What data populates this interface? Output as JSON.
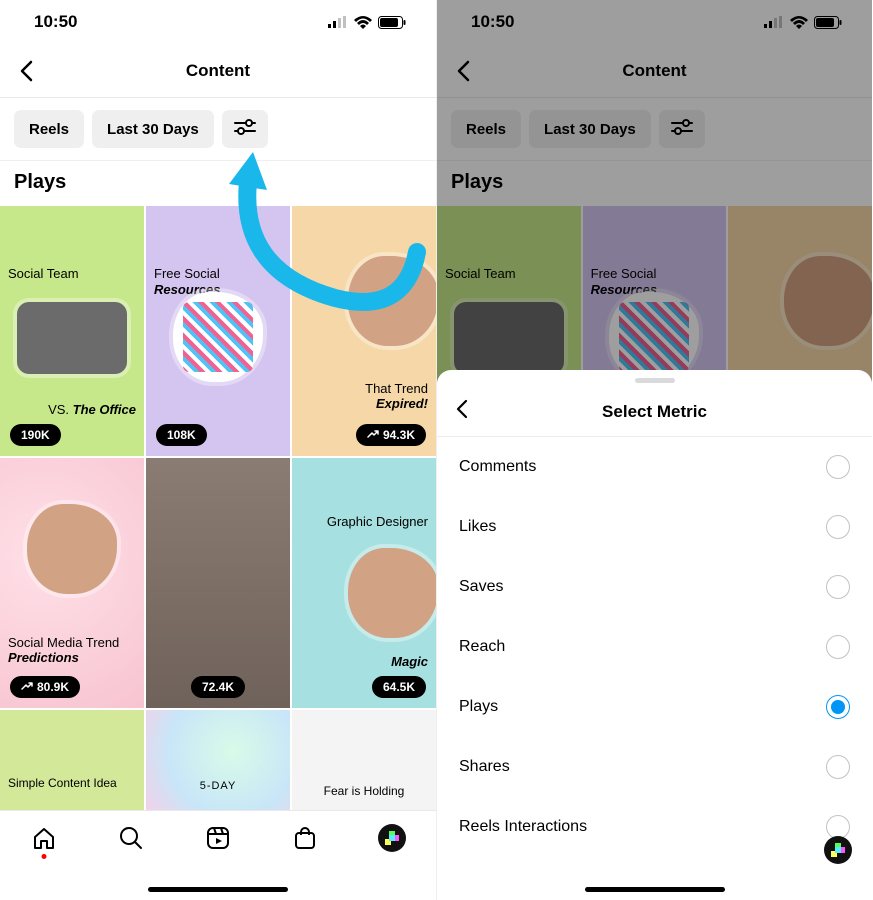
{
  "status": {
    "time": "10:50"
  },
  "header": {
    "title": "Content"
  },
  "chips": {
    "reels": "Reels",
    "period": "Last 30 Days"
  },
  "section": {
    "title": "Plays"
  },
  "tiles": [
    {
      "top": "Social Team",
      "bottom_html": "VS. The Office",
      "bottom_prefix": "VS. ",
      "bottom_em": "The Office",
      "count": "190K",
      "trend": false
    },
    {
      "top": "Free Social",
      "top_em": "Resources",
      "count": "108K",
      "trend": false
    },
    {
      "top": "",
      "bottom_prefix": "That Trend ",
      "bottom_em": "Expired!",
      "count": "94.3K",
      "trend": true
    },
    {
      "bottom_prefix": "Social Media Trend ",
      "bottom_em": "Predictions",
      "count": "80.9K",
      "trend": true
    },
    {
      "count": "72.4K",
      "trend": false
    },
    {
      "top": "Graphic Designer",
      "bottom_em": "Magic",
      "count": "64.5K",
      "trend": false
    },
    {
      "top": "Simple Content Idea"
    },
    {
      "top": "5-DAY"
    },
    {
      "top": "Fear is Holding"
    }
  ],
  "sheet": {
    "title": "Select Metric",
    "options": [
      "Comments",
      "Likes",
      "Saves",
      "Reach",
      "Plays",
      "Shares",
      "Reels Interactions"
    ],
    "selected": "Plays"
  }
}
